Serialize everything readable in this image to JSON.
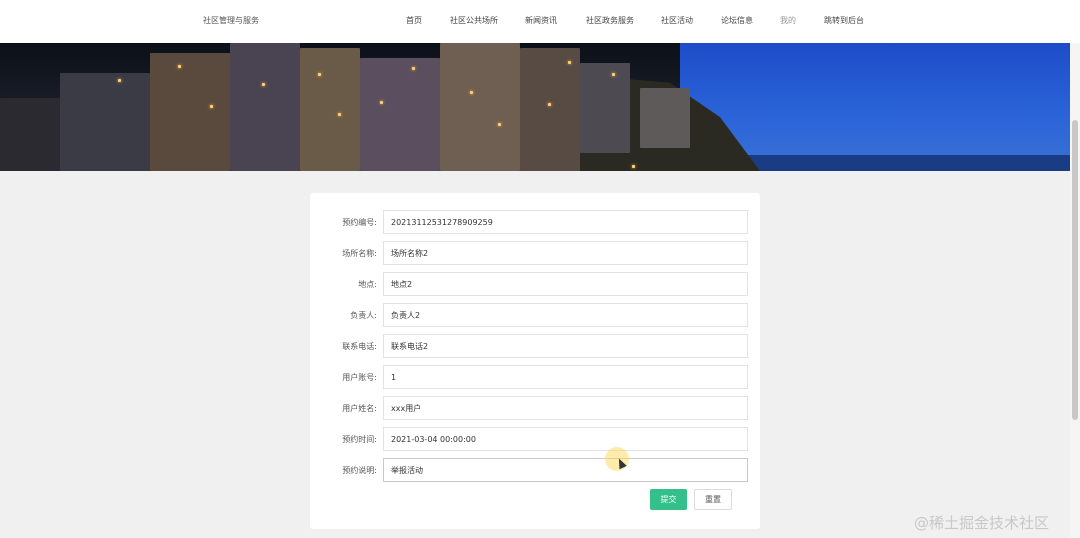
{
  "header": {
    "brand": "社区管理与服务",
    "nav": [
      "首页",
      "社区公共场所",
      "新闻资讯",
      "社区政务服务",
      "社区活动",
      "论坛信息",
      "我的",
      "跳转到后台"
    ]
  },
  "form": {
    "fields": [
      {
        "label": "预约编号:",
        "value": "20213112531278909259"
      },
      {
        "label": "场所名称:",
        "value": "场所名称2"
      },
      {
        "label": "地点:",
        "value": "地点2"
      },
      {
        "label": "负责人:",
        "value": "负责人2"
      },
      {
        "label": "联系电话:",
        "value": "联系电话2"
      },
      {
        "label": "用户账号:",
        "value": "1"
      },
      {
        "label": "用户姓名:",
        "value": "xxx用户"
      },
      {
        "label": "预约时间:",
        "value": "2021-03-04 00:00:00"
      },
      {
        "label": "预约说明:",
        "value": "举报活动"
      }
    ],
    "submit_label": "提交",
    "reset_label": "重置"
  },
  "watermark": "@稀土掘金技术社区",
  "colors": {
    "accent": "#34c08a",
    "sky": "#2a63d8",
    "background": "#f0f0f0"
  }
}
